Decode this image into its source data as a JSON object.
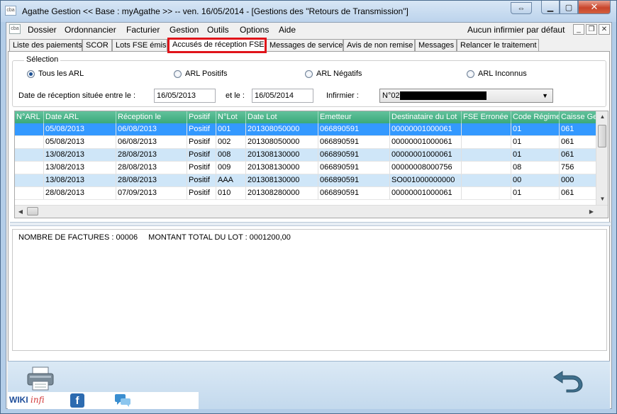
{
  "window": {
    "app_icon": "cba",
    "title": "Agathe Gestion << Base : myAgathe >>   --   ven. 16/05/2014  - [Gestions des \"Retours de Transmission\"]"
  },
  "menu": {
    "items": [
      "Dossier",
      "Ordonnancier",
      "Facturier",
      "Gestion",
      "Outils",
      "Options",
      "Aide"
    ],
    "right_text": "Aucun infirmier par défaut"
  },
  "tabs": [
    "Liste des paiements",
    "SCOR",
    "Lots FSE émis",
    "Accusés de réception FSE",
    "Messages de service",
    "Avis de non remise",
    "Messages",
    "Relancer le traitement"
  ],
  "active_tab_index": 3,
  "selection": {
    "legend": "Sélection",
    "radios": [
      "Tous les ARL",
      "ARL Positifs",
      "ARL Négatifs",
      "ARL Inconnus"
    ],
    "checked_index": 0,
    "date_label": "Date de réception située entre le :",
    "date_from": "16/05/2013",
    "and_label": "et le :",
    "date_to": "16/05/2014",
    "infirmier_label": "Infirmier :",
    "infirmier_value": "N°02"
  },
  "grid": {
    "columns": [
      "N°ARL",
      "Date ARL",
      "Réception le",
      "Positif",
      "N°Lot",
      "Date Lot",
      "Emetteur",
      "Destinataire du Lot",
      "FSE Erronée",
      "Code Régime",
      "Caisse Gest"
    ],
    "rows": [
      [
        "",
        "05/08/2013",
        "06/08/2013",
        "Positif",
        "001",
        "201308050000",
        "066890591",
        "00000001000061",
        "",
        "01",
        "061"
      ],
      [
        "",
        "05/08/2013",
        "06/08/2013",
        "Positif",
        "002",
        "201308050000",
        "066890591",
        "00000001000061",
        "",
        "01",
        "061"
      ],
      [
        "",
        "13/08/2013",
        "28/08/2013",
        "Positif",
        "008",
        "201308130000",
        "066890591",
        "00000001000061",
        "",
        "01",
        "061"
      ],
      [
        "",
        "13/08/2013",
        "28/08/2013",
        "Positif",
        "009",
        "201308130000",
        "066890591",
        "00000008000756",
        "",
        "08",
        "756"
      ],
      [
        "",
        "13/08/2013",
        "28/08/2013",
        "Positif",
        "AAA",
        "201308130000",
        "066890591",
        "SO001000000000",
        "",
        "00",
        "000"
      ],
      [
        "",
        "28/08/2013",
        "07/09/2013",
        "Positif",
        "010",
        "201308280000",
        "066890591",
        "00000001000061",
        "",
        "01",
        "061"
      ]
    ],
    "selected_row": 0
  },
  "detail": {
    "nb_factures": "NOMBRE DE FACTURES : 00006",
    "montant": "MONTANT TOTAL DU LOT : 0001200,00"
  },
  "bottom": {
    "wiki_a": "WIKI",
    "wiki_b": "infi",
    "fb": "f"
  },
  "colors": {
    "header_green": "#3aa97a",
    "selected_blue": "#3399ff",
    "alt_row": "#cfe6f8",
    "highlight_red": "#e0141a"
  }
}
